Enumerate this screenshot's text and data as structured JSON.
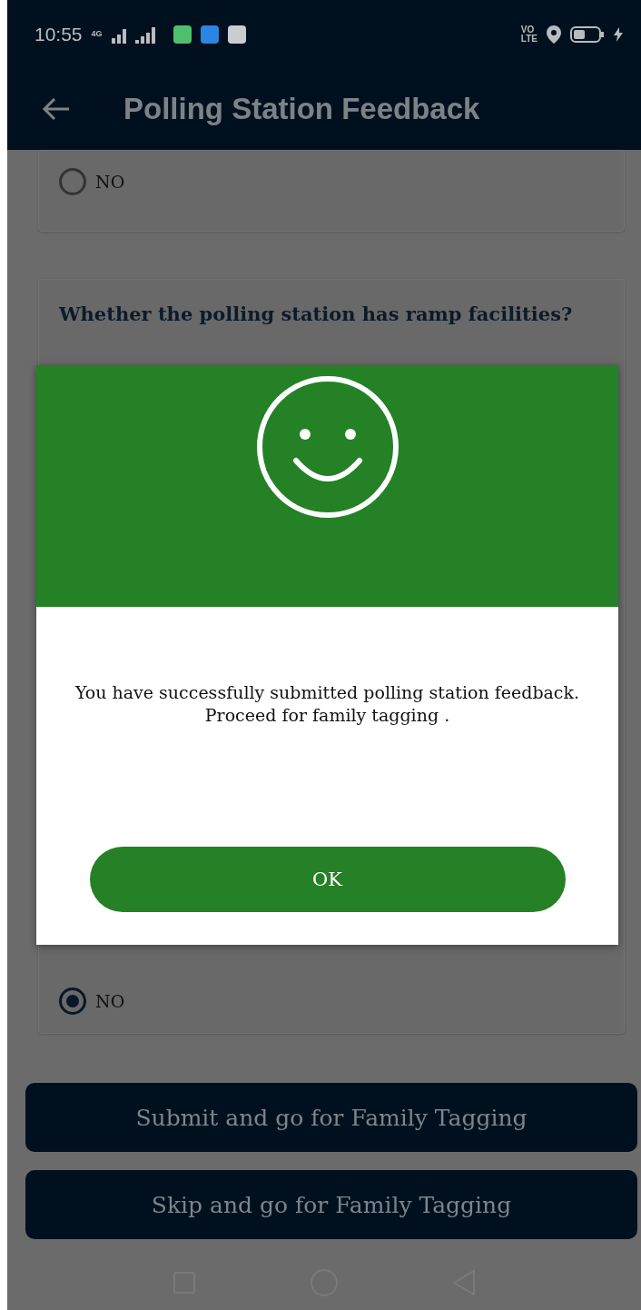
{
  "status_bar": {
    "time": "10:55",
    "network": "4G",
    "volte": [
      "VO",
      "LTE"
    ]
  },
  "header": {
    "title": "Polling Station Feedback"
  },
  "questions": [
    {
      "options": [
        {
          "label": "NO",
          "selected": false
        }
      ]
    },
    {
      "question": "Whether the polling station has ramp facilities?",
      "options": [
        {
          "label": "NO",
          "selected": true
        }
      ]
    }
  ],
  "buttons": [
    "Submit and go for Family Tagging",
    "Skip and go for Family Tagging"
  ],
  "dialog": {
    "message": "You have successfully submitted polling station feedback. Proceed for family tagging .",
    "ok_button": "OK"
  }
}
